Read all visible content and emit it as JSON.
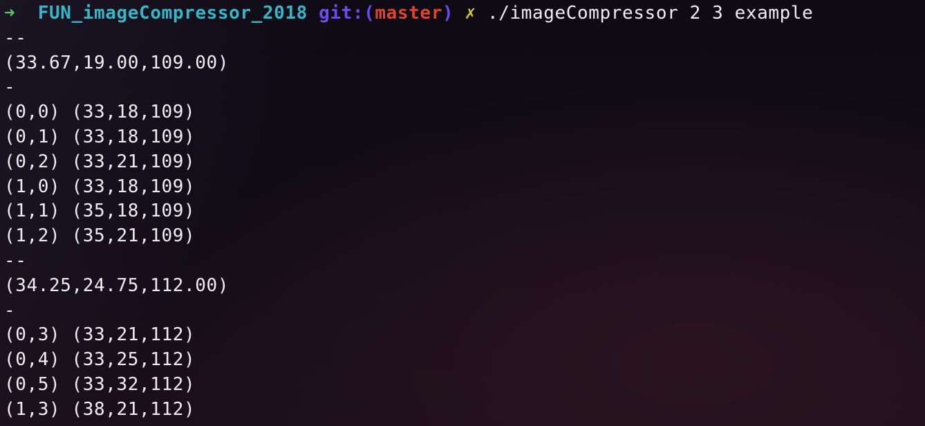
{
  "prompt": {
    "arrow": "➜",
    "cwd": "FUN_imageCompressor_2018",
    "git_label": "git:(",
    "git_branch": "master",
    "git_close": ")",
    "dirty_marker": "✗",
    "command": "./imageCompressor 2 3 example"
  },
  "output_lines": [
    "--",
    "(33.67,19.00,109.00)",
    "-",
    "(0,0) (33,18,109)",
    "(0,1) (33,18,109)",
    "(0,2) (33,21,109)",
    "(1,0) (33,18,109)",
    "(1,1) (35,18,109)",
    "(1,2) (35,21,109)",
    "--",
    "(34.25,24.75,112.00)",
    "-",
    "(0,3) (33,21,112)",
    "(0,4) (33,25,112)",
    "(0,5) (33,32,112)",
    "(1,3) (38,21,112)"
  ],
  "colors": {
    "arrow": "#57c95f",
    "cwd": "#36b7c9",
    "git_label": "#6a4df0",
    "git_branch": "#e0442f",
    "dirty": "#d4c63a",
    "text": "#f2eff4",
    "background": "#120c16"
  }
}
